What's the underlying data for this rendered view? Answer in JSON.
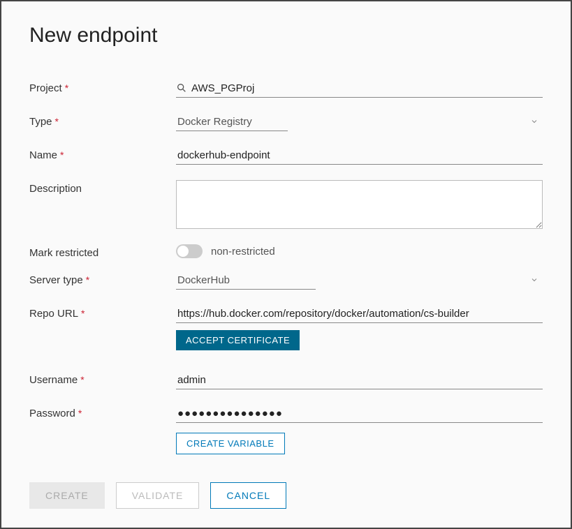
{
  "title": "New endpoint",
  "labels": {
    "project": "Project",
    "type": "Type",
    "name": "Name",
    "description": "Description",
    "mark_restricted": "Mark restricted",
    "server_type": "Server type",
    "repo_url": "Repo URL",
    "username": "Username",
    "password": "Password"
  },
  "required_mark": "*",
  "fields": {
    "project": "AWS_PGProj",
    "type": "Docker Registry",
    "name": "dockerhub-endpoint",
    "description": "",
    "restricted_state": "non-restricted",
    "server_type": "DockerHub",
    "repo_url": "https://hub.docker.com/repository/docker/automation/cs-builder",
    "username": "admin",
    "password": "●●●●●●●●●●●●●●●"
  },
  "buttons": {
    "accept_cert": "ACCEPT CERTIFICATE",
    "create_var": "CREATE VARIABLE",
    "create": "CREATE",
    "validate": "VALIDATE",
    "cancel": "CANCEL"
  }
}
